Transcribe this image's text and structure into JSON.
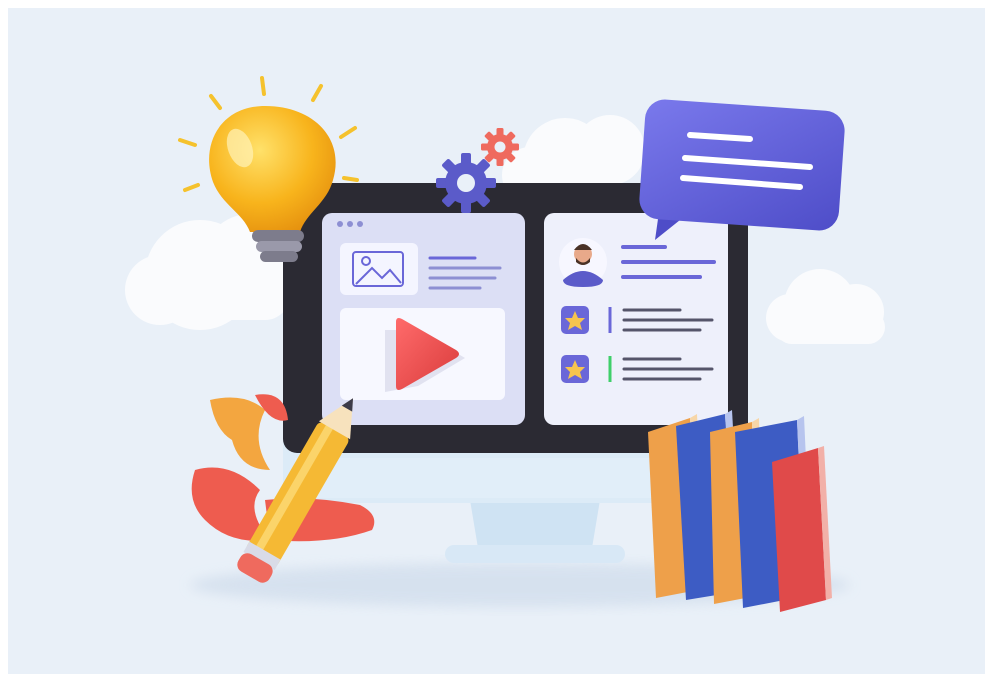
{
  "scene": {
    "colors": {
      "background": "#e9f0f8",
      "monitor_frame": "#2b2a33",
      "monitor_stand": "#d6e6f4",
      "panel": "#eef0fb",
      "accent_purple": "#6a67d8",
      "play_red": "#ef5454",
      "bulb_yellow": "#f8b41c",
      "book_orange": "#eea04a",
      "book_blue": "#3d5cc4",
      "book_red": "#e04a4a",
      "star_gold": "#f6c44e"
    },
    "icons": [
      "light-bulb-icon",
      "gear-icon",
      "chat-bubble-icon",
      "image-icon",
      "play-icon",
      "user-avatar-icon",
      "star-icon",
      "pencil-icon",
      "book-icon",
      "cloud-icon",
      "leaf-icon"
    ]
  }
}
